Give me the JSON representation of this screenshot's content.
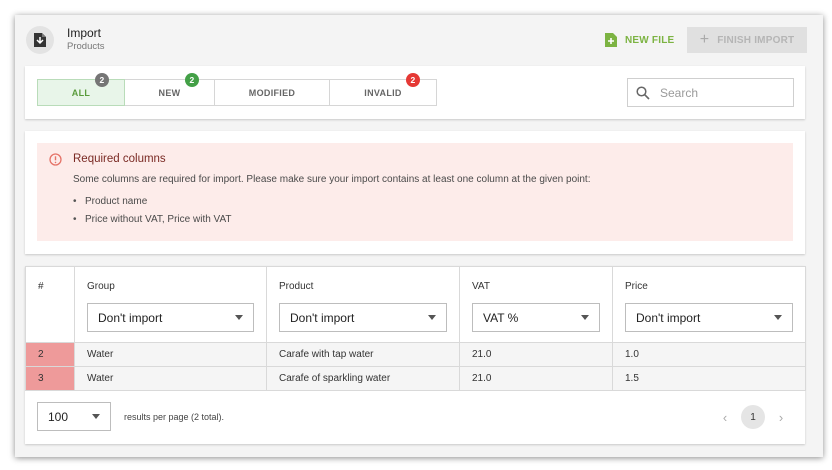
{
  "header": {
    "title": "Import",
    "subtitle": "Products",
    "new_file_label": "NEW FILE",
    "finish_label": "FINISH IMPORT"
  },
  "tabs": [
    {
      "label": "ALL",
      "count": "2",
      "badge_color": "#757575",
      "active": true
    },
    {
      "label": "NEW",
      "count": "2",
      "badge_color": "#43a047",
      "active": false
    },
    {
      "label": "MODIFIED",
      "count": "",
      "badge_color": "",
      "active": false
    },
    {
      "label": "INVALID",
      "count": "2",
      "badge_color": "#e53935",
      "active": false
    }
  ],
  "search": {
    "placeholder": "Search",
    "value": ""
  },
  "alert": {
    "title": "Required columns",
    "message": "Some columns are required for import. Please make sure your import contains at least one column at the given point:",
    "items": [
      "Product name",
      "Price without VAT, Price with VAT"
    ]
  },
  "table": {
    "columns": [
      {
        "label": "#",
        "mapping": ""
      },
      {
        "label": "Group",
        "mapping": "Don't import"
      },
      {
        "label": "Product",
        "mapping": "Don't import"
      },
      {
        "label": "VAT",
        "mapping": "VAT %"
      },
      {
        "label": "Price",
        "mapping": "Don't import"
      }
    ],
    "rows": [
      [
        "2",
        "Water",
        "Carafe with tap water",
        "21.0",
        "1.0"
      ],
      [
        "3",
        "Water",
        "Carafe of sparkling water",
        "21.0",
        "1.5"
      ]
    ]
  },
  "pagination": {
    "page_size": "100",
    "results_text": "results per page (2 total).",
    "current_page": "1"
  },
  "colors": {
    "accent_green": "#7cb342",
    "invalid_row": "#ee9a9a",
    "alert_bg": "#fdecea"
  }
}
